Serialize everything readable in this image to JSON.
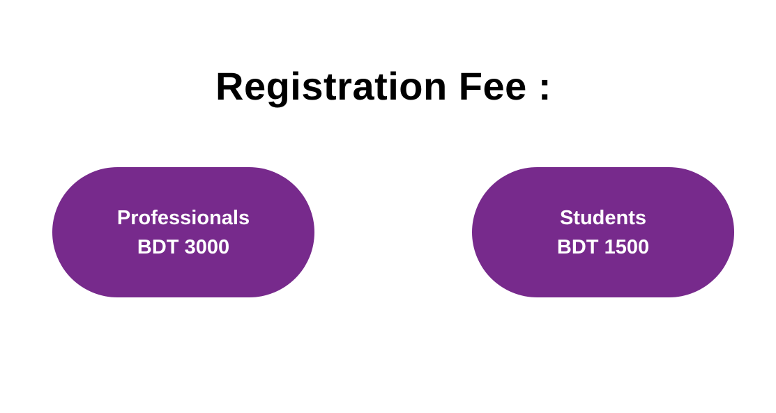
{
  "title": "Registration Fee :",
  "colors": {
    "pill_background": "#772a8c",
    "pill_text": "#ffffff",
    "title_text": "#000000",
    "page_background": "#ffffff"
  },
  "fees": [
    {
      "category": "Professionals",
      "amount": "BDT 3000"
    },
    {
      "category": "Students",
      "amount": "BDT 1500"
    }
  ]
}
